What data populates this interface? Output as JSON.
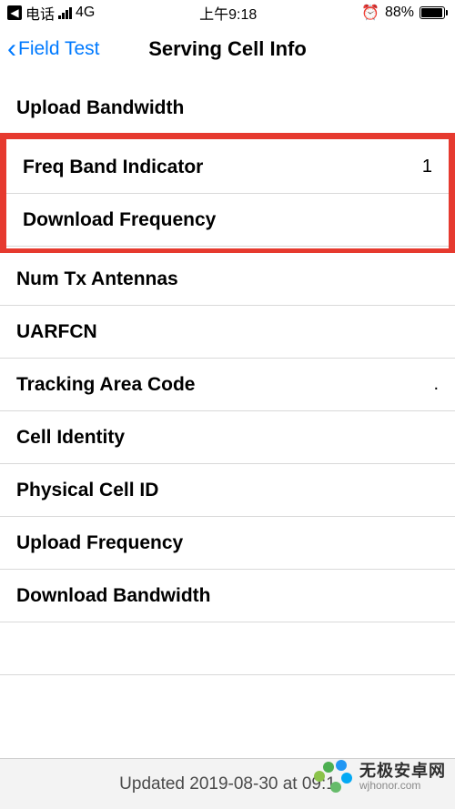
{
  "statusBar": {
    "carrier": "电话",
    "network": "4G",
    "time": "上午9:18",
    "batteryPct": "88%"
  },
  "nav": {
    "back": "Field Test",
    "title": "Serving Cell Info"
  },
  "rows": {
    "uploadBandwidth": {
      "label": "Upload Bandwidth",
      "value": ""
    },
    "freqBandIndicator": {
      "label": "Freq Band Indicator",
      "value": "1"
    },
    "downloadFrequency": {
      "label": "Download Frequency",
      "value": ""
    },
    "numTxAntennas": {
      "label": "Num Tx Antennas",
      "value": ""
    },
    "uarfcn": {
      "label": "UARFCN",
      "value": ""
    },
    "trackingAreaCode": {
      "label": "Tracking Area Code",
      "value": "."
    },
    "cellIdentity": {
      "label": "Cell Identity",
      "value": ""
    },
    "physicalCellId": {
      "label": "Physical Cell ID",
      "value": ""
    },
    "uploadFrequency": {
      "label": "Upload Frequency",
      "value": ""
    },
    "downloadBandwidth": {
      "label": "Download Bandwidth",
      "value": ""
    }
  },
  "footer": {
    "updated": "Updated 2019-08-30 at 09:1"
  },
  "watermark": {
    "name": "无极安卓网",
    "url": "wjhonor.com"
  }
}
